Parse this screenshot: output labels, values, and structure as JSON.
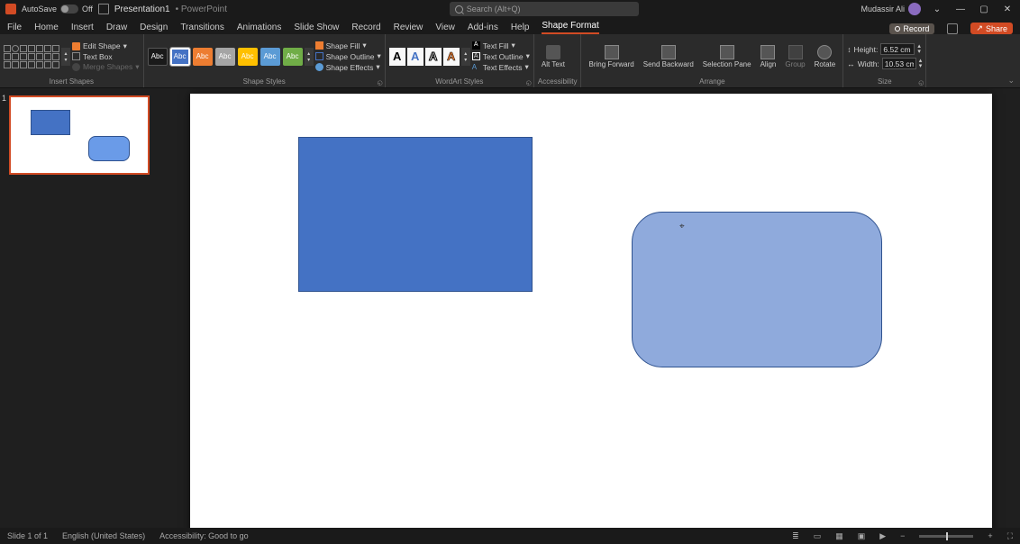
{
  "titlebar": {
    "autosave_label": "AutoSave",
    "autosave_state": "Off",
    "doc_title": "Presentation1",
    "app_name": "PowerPoint",
    "search_placeholder": "Search (Alt+Q)",
    "user_name": "Mudassir Ali"
  },
  "tabs": {
    "items": [
      "File",
      "Home",
      "Insert",
      "Draw",
      "Design",
      "Transitions",
      "Animations",
      "Slide Show",
      "Record",
      "Review",
      "View",
      "Add-ins",
      "Help",
      "Shape Format"
    ],
    "active": "Shape Format",
    "record_label": "Record",
    "share_label": "Share"
  },
  "ribbon": {
    "insert_shapes": {
      "label": "Insert Shapes",
      "edit_shape": "Edit Shape",
      "text_box": "Text Box",
      "merge_shapes": "Merge Shapes"
    },
    "shape_styles": {
      "label": "Shape Styles",
      "swatch_text": "Abc",
      "fill": "Shape Fill",
      "outline": "Shape Outline",
      "effects": "Shape Effects"
    },
    "wordart": {
      "label": "WordArt Styles",
      "glyph": "A",
      "text_fill": "Text Fill",
      "text_outline": "Text Outline",
      "text_effects": "Text Effects"
    },
    "accessibility": {
      "label": "Accessibility",
      "alt_text": "Alt Text"
    },
    "arrange": {
      "label": "Arrange",
      "bring_forward": "Bring Forward",
      "send_backward": "Send Backward",
      "selection_pane": "Selection Pane",
      "align": "Align",
      "group": "Group",
      "rotate": "Rotate"
    },
    "size": {
      "label": "Size",
      "height_label": "Height:",
      "height_value": "6.52 cm",
      "width_label": "Width:",
      "width_value": "10.53 cm"
    }
  },
  "thumb": {
    "number": "1"
  },
  "status": {
    "slide_info": "Slide 1 of 1",
    "language": "English (United States)",
    "accessibility": "Accessibility: Good to go"
  }
}
